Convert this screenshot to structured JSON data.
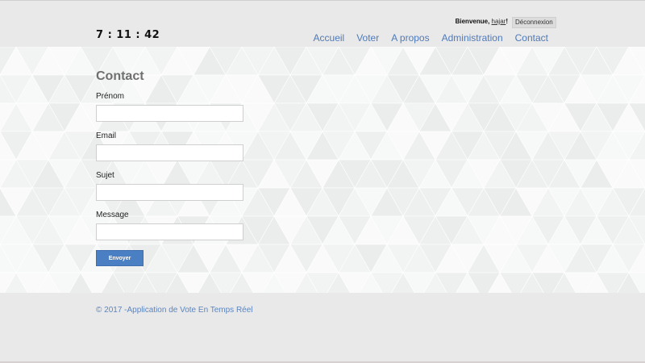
{
  "header": {
    "clock": "7 : 11 : 42",
    "welcome_prefix": "Bienvenue,",
    "username": "hajar",
    "welcome_suffix": "!",
    "logout_label": "Déconnexion",
    "nav": [
      {
        "label": "Accueil"
      },
      {
        "label": "Voter"
      },
      {
        "label": "A propos"
      },
      {
        "label": "Administration"
      },
      {
        "label": "Contact"
      }
    ]
  },
  "form": {
    "title": "Contact",
    "fields": [
      {
        "label": "Prénom",
        "value": "",
        "placeholder": ""
      },
      {
        "label": "Email",
        "value": "",
        "placeholder": ""
      },
      {
        "label": "Sujet",
        "value": "",
        "placeholder": ""
      },
      {
        "label": "Message",
        "value": "",
        "placeholder": ""
      }
    ],
    "submit_label": "Envoyer"
  },
  "footer": {
    "copyright": "© 2017 -Application de Vote En Temps Réel"
  },
  "colors": {
    "accent": "#4f7ab9",
    "button": "#4b7fc4",
    "background": "#e9e9e9"
  }
}
